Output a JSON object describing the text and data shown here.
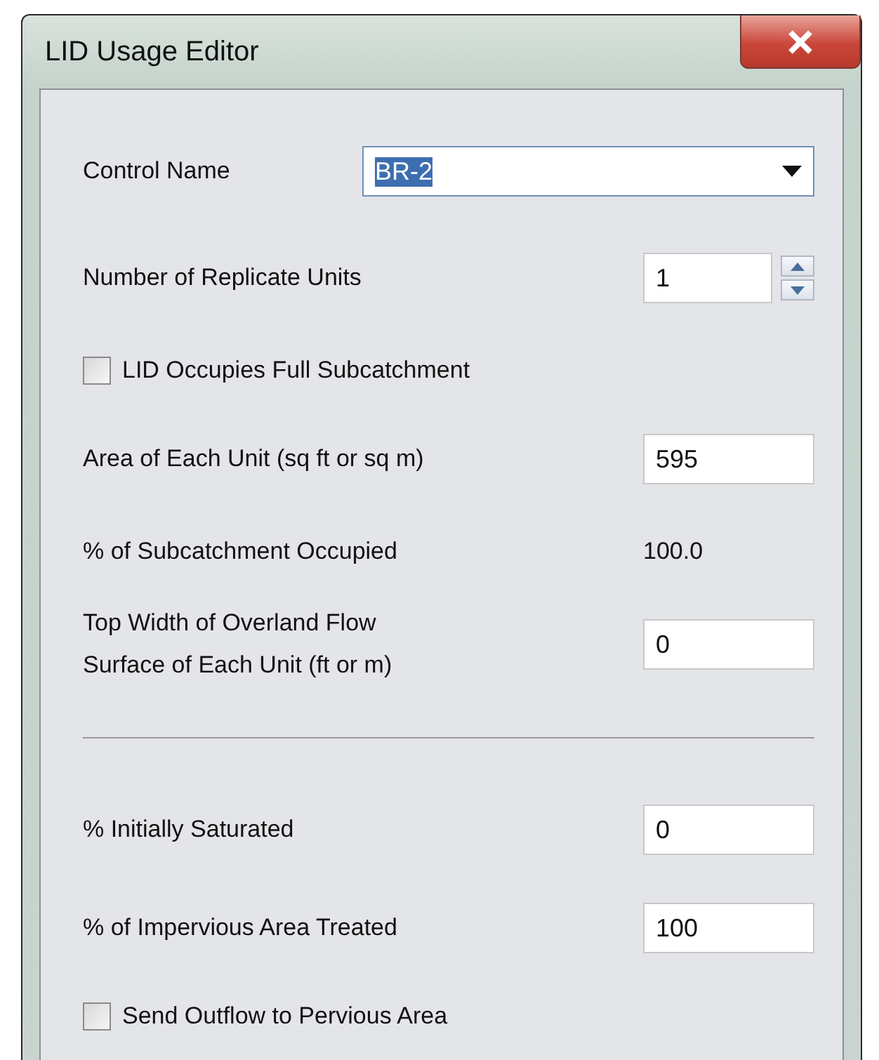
{
  "window": {
    "title": "LID Usage Editor"
  },
  "rows": [
    {
      "kind": "dropdown",
      "label": "Control Name",
      "value": "BR-2",
      "text_selected": true
    },
    {
      "kind": "spinner",
      "label": "Number of Replicate Units",
      "value": "1"
    },
    {
      "kind": "checkbox",
      "label": "LID Occupies Full Subcatchment",
      "checked": false
    },
    {
      "kind": "input",
      "label": "Area of Each Unit (sq ft or sq m)",
      "value": "595"
    },
    {
      "kind": "readout",
      "label": "% of Subcatchment Occupied",
      "value": "100.0"
    },
    {
      "kind": "input",
      "label": "Top Width of Overland Flow\nSurface of Each Unit (ft or m)",
      "value": "0"
    },
    {
      "kind": "divider"
    },
    {
      "kind": "input",
      "label": "% Initially Saturated",
      "value": "0"
    },
    {
      "kind": "input",
      "label": "% of Impervious Area Treated",
      "value": "100"
    },
    {
      "kind": "checkbox",
      "label": "Send Outflow to Pervious Area",
      "checked": false
    }
  ]
}
